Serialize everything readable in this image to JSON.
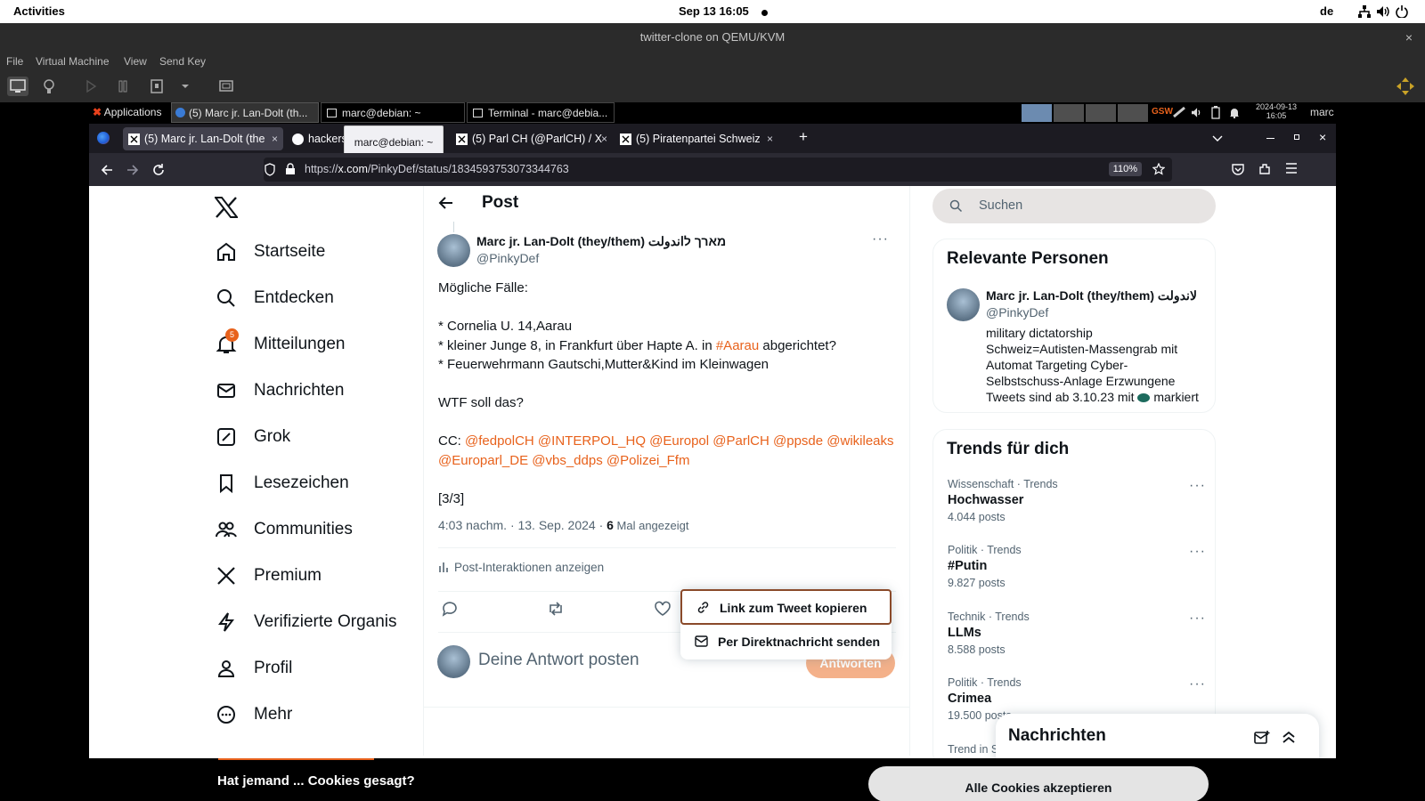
{
  "gnome": {
    "activities": "Activities",
    "clock": "Sep 13  16:05",
    "lang": "de"
  },
  "vm": {
    "title": "twitter-clone on QEMU/KVM",
    "close": "×",
    "menu": [
      "File",
      "Virtual Machine",
      "View",
      "Send Key"
    ]
  },
  "guest_panel": {
    "tasks": [
      {
        "label": "Applications"
      },
      {
        "label": "(5) Marc jr. Lan-Dolt (th..."
      },
      {
        "label": "marc@debian: ~"
      },
      {
        "label": "Terminal - marc@debia..."
      }
    ],
    "netmon": "GSW",
    "datetime_date": "2024-09-13",
    "datetime_time": "16:05",
    "user": "marc"
  },
  "firefox": {
    "tabs": [
      {
        "label": "(5) Marc jr. Lan-Dolt (the"
      },
      {
        "label": "hackerstar..."
      },
      {
        "label": "(5) Parl CH (@ParlCH) / X"
      },
      {
        "label": "(5) Piratenpartei Schweiz"
      }
    ],
    "tab_close": "×",
    "new_tab": "+",
    "tooltip": "marc@debian: ~",
    "url_pre": "https://",
    "url_host": "x.com",
    "url_path": "/PinkyDef/status/1834593753073344763",
    "zoom": "110%"
  },
  "sidebar": {
    "items": [
      {
        "label": "Startseite",
        "icon": "home-icon"
      },
      {
        "label": "Entdecken",
        "icon": "search-icon"
      },
      {
        "label": "Mitteilungen",
        "icon": "bell-icon",
        "badge": "5"
      },
      {
        "label": "Nachrichten",
        "icon": "mail-icon"
      },
      {
        "label": "Grok",
        "icon": "grok-icon"
      },
      {
        "label": "Lesezeichen",
        "icon": "bookmark-icon"
      },
      {
        "label": "Communities",
        "icon": "people-icon"
      },
      {
        "label": "Premium",
        "icon": "x-logo-icon"
      },
      {
        "label": "Verifizierte Organis",
        "icon": "lightning-icon"
      },
      {
        "label": "Profil",
        "icon": "person-icon"
      },
      {
        "label": "Mehr",
        "icon": "more-circle-icon"
      }
    ]
  },
  "post": {
    "header": "Post",
    "author_name": "Marc jr. Lan-Dolt (they/them) מארך לاندولت",
    "author_handle": "@PinkyDef",
    "line1": "Mögliche Fälle:",
    "line2": "* Cornelia U. 14,Aarau",
    "line3_pre": "* kleiner Junge 8, in Frankfurt über Hapte A. in ",
    "line3_tag": "#Aarau",
    "line3_post": " abgerichtet?",
    "line4": "* Feuerwehrmann Gautschi,Mutter&Kind im Kleinwagen",
    "line5": "WTF soll das?",
    "cc_label": "CC: ",
    "cc_row1": "@fedpolCH @INTERPOL_HQ @Europol @ParlCH @ppsde @wikileaks",
    "cc_row2": "@Europarl_DE @vbs_ddps @Polizei_Ffm",
    "page_count": "[3/3]",
    "meta_time": "4:03 nachm. · 13. Sep. 2024 · ",
    "meta_views": "6",
    "meta_views_label": " Mal angezeigt",
    "interactions": "Post-Interaktionen anzeigen",
    "reply_placeholder": "Deine Antwort posten",
    "reply_button": "Antworten"
  },
  "share_menu": {
    "copy_link": "Link zum Tweet kopieren",
    "send_dm": "Per Direktnachricht senden"
  },
  "search": {
    "placeholder": "Suchen"
  },
  "relevant": {
    "title": "Relevante Personen",
    "name": "Marc jr. Lan-Dolt (they/them) لاندولت",
    "handle": "@PinkyDef",
    "bio1": "military dictatorship",
    "bio2": "Schweiz=Autisten-Massengrab mit",
    "bio3": "Automat Targeting Cyber-",
    "bio4": "Selbstschuss-Anlage Erzwungene",
    "bio5_pre": "Tweets sind ab 3.10.23 mit ",
    "bio5_post": " markiert"
  },
  "trends": {
    "title": "Trends für dich",
    "items": [
      {
        "category": "Wissenschaft · Trends",
        "name": "Hochwasser",
        "count": "4.044 posts"
      },
      {
        "category": "Politik · Trends",
        "name": "#Putin",
        "count": "9.827 posts"
      },
      {
        "category": "Technik · Trends",
        "name": "LLMs",
        "count": "8.588 posts"
      },
      {
        "category": "Politik · Trends",
        "name": "Crimea",
        "count": "19.500 posts"
      },
      {
        "category": "Trend in S"
      }
    ],
    "more": "···"
  },
  "messages_drawer": {
    "title": "Nachrichten"
  },
  "cookie_banner": {
    "text": "Hat jemand ... Cookies gesagt?",
    "accept": "Alle Cookies akzeptieren"
  },
  "colors": {
    "accent": "#e8621c",
    "text": "#0f1419",
    "muted": "#536471",
    "firefox_chrome": "#2b2a33"
  }
}
